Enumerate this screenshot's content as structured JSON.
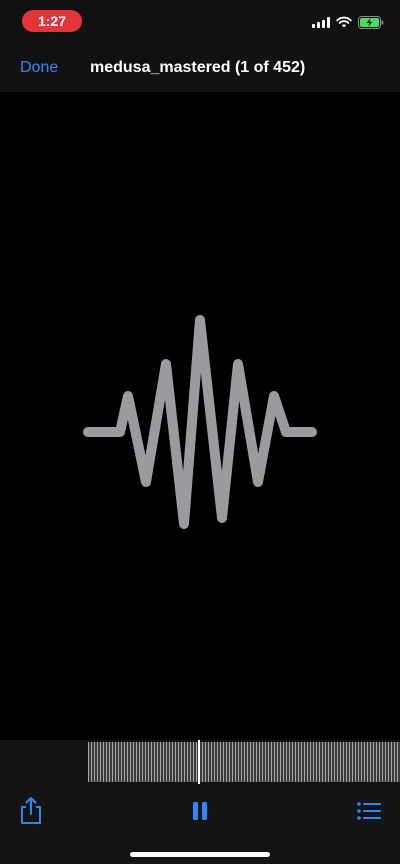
{
  "status_bar": {
    "time": "1:27",
    "icons": [
      "signal-icon",
      "wifi-icon",
      "battery-charging-icon"
    ],
    "colors": {
      "time_pill": "#e5333b",
      "battery": "#4cd964"
    }
  },
  "nav_bar": {
    "done_label": "Done",
    "title": "medusa_mastered (1 of 452)",
    "colors": {
      "accent": "#2f86f6"
    }
  },
  "preview": {
    "icon": "audio-waveform-icon",
    "colors": {
      "waveform": "#9a9a9f",
      "background": "#000000"
    }
  },
  "scrubber": {
    "icon": "audio-scrubber"
  },
  "toolbar": {
    "share_icon": "share-icon",
    "pause_icon": "pause-icon",
    "list_icon": "list-icon"
  }
}
